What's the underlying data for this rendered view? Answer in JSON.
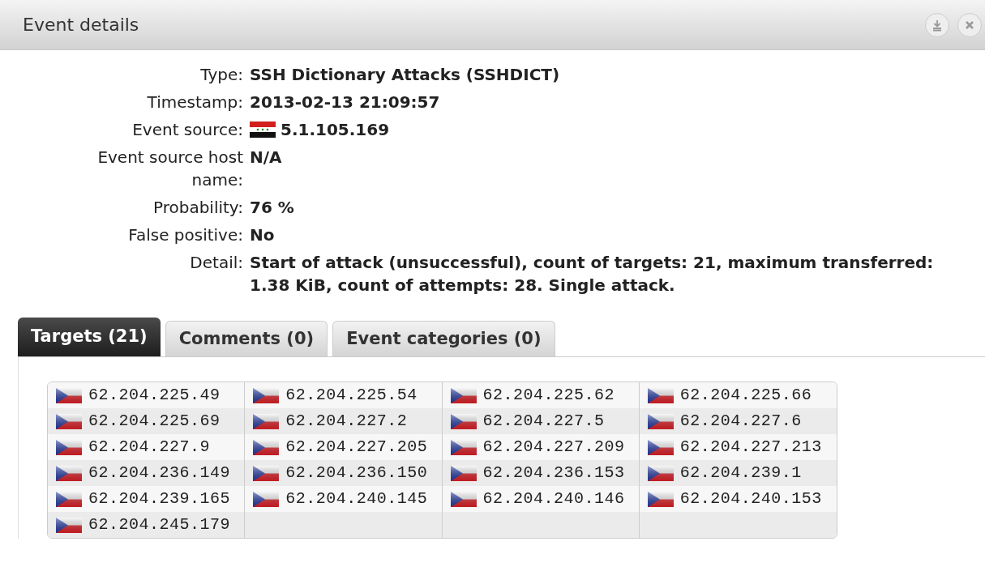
{
  "window": {
    "title": "Event details"
  },
  "fields": [
    {
      "label": "Type:",
      "value": "SSH Dictionary Attacks (SSHDICT)"
    },
    {
      "label": "Timestamp:",
      "value": "2013-02-13 21:09:57"
    },
    {
      "label": "Event source:",
      "value": "5.1.105.169",
      "flag": true
    },
    {
      "label": "Event source host name:",
      "value": "N/A"
    },
    {
      "label": "Probability:",
      "value": "76 %"
    },
    {
      "label": "False positive:",
      "value": "No"
    },
    {
      "label": "Detail:",
      "value": "Start of attack (unsuccessful), count of targets: 21, maximum transferred: 1.38 KiB, count of attempts: 28. Single attack."
    }
  ],
  "tabs": [
    {
      "label": "Targets (21)",
      "selected": true
    },
    {
      "label": "Comments (0)",
      "selected": false
    },
    {
      "label": "Event categories (0)",
      "selected": false
    }
  ],
  "targets": [
    [
      "62.204.225.49",
      "62.204.225.54",
      "62.204.225.62",
      "62.204.225.66"
    ],
    [
      "62.204.225.69",
      "62.204.227.2",
      "62.204.227.5",
      "62.204.227.6"
    ],
    [
      "62.204.227.9",
      "62.204.227.205",
      "62.204.227.209",
      "62.204.227.213"
    ],
    [
      "62.204.236.149",
      "62.204.236.150",
      "62.204.236.153",
      "62.204.239.1"
    ],
    [
      "62.204.239.165",
      "62.204.240.145",
      "62.204.240.146",
      "62.204.240.153"
    ],
    [
      "62.204.245.179"
    ]
  ]
}
